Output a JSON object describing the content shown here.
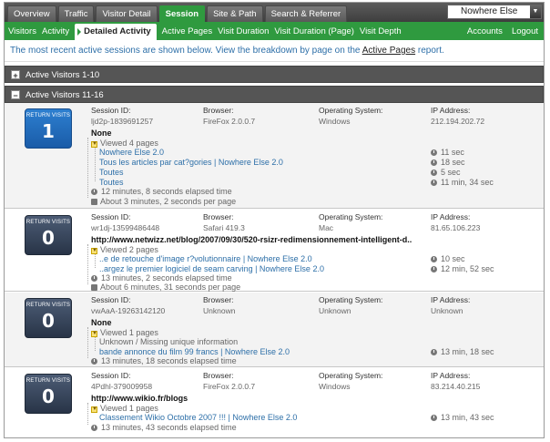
{
  "top_tabs": [
    "Overview",
    "Traffic",
    "Visitor Detail",
    "Session",
    "Site & Path",
    "Search & Referrer"
  ],
  "site_select": {
    "value": "Nowhere Else"
  },
  "subnav": {
    "items": [
      "Visitors",
      "Activity",
      "Detailed Activity",
      "Active Pages",
      "Visit Duration",
      "Visit Duration (Page)",
      "Visit Depth"
    ],
    "right": [
      "Accounts",
      "Logout"
    ]
  },
  "intro": {
    "text": "The most recent active sessions are shown below. View the breakdown by page on the",
    "link": "Active Pages",
    "suffix": "report."
  },
  "groups": {
    "collapsed": {
      "toggle": "+",
      "label": "Active Visitors 1-10"
    },
    "expanded": {
      "toggle": "−",
      "label": "Active Visitors 11-16"
    }
  },
  "labels": {
    "return_visits": "RETURN VISITS",
    "session_id": "Session ID:",
    "browser": "Browser:",
    "os": "Operating System:",
    "ip": "IP Address:"
  },
  "sessions": [
    {
      "return_visits": "1",
      "session_id": "ljd2p-1839691257",
      "browser": "FireFox 2.0.0.7",
      "os": "Windows",
      "ip": "212.194.202.72",
      "referrer": "None",
      "viewed": "Viewed 4 pages",
      "pages": [
        "Nowhere Else 2.0",
        "Tous les articles par cat?gories | Nowhere Else 2.0",
        "Toutes",
        "Toutes"
      ],
      "times": [
        "11 sec",
        "18 sec",
        "5 sec",
        "11 min, 34 sec"
      ],
      "elapsed": "12 minutes, 8 seconds elapsed time",
      "per_page": "About 3 minutes, 2 seconds per page"
    },
    {
      "return_visits": "0",
      "session_id": "wr1dj-13599486448",
      "browser": "Safari 419.3",
      "os": "Mac",
      "ip": "81.65.106.223",
      "referrer": "http://www.netwizz.net/blog/2007/09/30/520-rsizr-redimensionnement-intelligent-d..",
      "viewed": "Viewed 2 pages",
      "pages": [
        "..e de retouche d'image r?volutionnaire | Nowhere Else 2.0",
        "..argez le premier logiciel de seam carving | Nowhere Else 2.0"
      ],
      "times": [
        "10 sec",
        "12 min, 52 sec"
      ],
      "elapsed": "13 minutes, 2 seconds elapsed time",
      "per_page": "About 6 minutes, 31 seconds per page"
    },
    {
      "return_visits": "0",
      "session_id": "vwAaA-19263142120",
      "browser": "Unknown",
      "os": "Unknown",
      "ip": "Unknown",
      "referrer": "None",
      "viewed": "Viewed 1 pages",
      "unknown": "Unknown / Missing unique information",
      "pages": [
        "bande annonce du film 99 francs | Nowhere Else 2.0"
      ],
      "times": [
        "13 min, 18 sec"
      ],
      "elapsed": "13 minutes, 18 seconds elapsed time"
    },
    {
      "return_visits": "0",
      "session_id": "4Pdhl-379009958",
      "browser": "FireFox 2.0.0.7",
      "os": "Windows",
      "ip": "83.214.40.215",
      "referrer": "http://www.wikio.fr/blogs",
      "viewed": "Viewed 1 pages",
      "pages": [
        "Classement Wikio Octobre 2007 !!! | Nowhere Else 2.0"
      ],
      "times": [
        "13 min, 43 sec"
      ],
      "elapsed": "13 minutes, 43 seconds elapsed time"
    }
  ]
}
